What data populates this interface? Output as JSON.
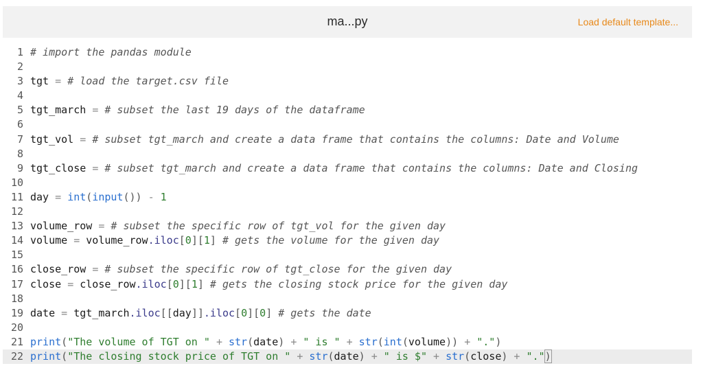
{
  "header": {
    "filename": "ma...py",
    "load_template_label": "Load default template..."
  },
  "colors": {
    "accent_link": "#e8891a",
    "header_bg": "#f2f2f2",
    "active_line_bg": "#ececec"
  },
  "code_lines": [
    {
      "n": "1",
      "tokens": [
        {
          "t": "# import the pandas module",
          "c": "comment"
        }
      ]
    },
    {
      "n": "2",
      "tokens": []
    },
    {
      "n": "3",
      "tokens": [
        {
          "t": "tgt ",
          "c": "var"
        },
        {
          "t": "=",
          "c": "op"
        },
        {
          "t": " ",
          "c": "var"
        },
        {
          "t": "# load the target.csv file",
          "c": "comment"
        }
      ]
    },
    {
      "n": "4",
      "tokens": []
    },
    {
      "n": "5",
      "tokens": [
        {
          "t": "tgt_march ",
          "c": "var"
        },
        {
          "t": "=",
          "c": "op"
        },
        {
          "t": " ",
          "c": "var"
        },
        {
          "t": "# subset the last 19 days of the dataframe",
          "c": "comment"
        }
      ]
    },
    {
      "n": "6",
      "tokens": []
    },
    {
      "n": "7",
      "tokens": [
        {
          "t": "tgt_vol ",
          "c": "var"
        },
        {
          "t": "=",
          "c": "op"
        },
        {
          "t": " ",
          "c": "var"
        },
        {
          "t": "# subset tgt_march and create a data frame that contains the columns: Date and Volume",
          "c": "comment"
        }
      ]
    },
    {
      "n": "8",
      "tokens": []
    },
    {
      "n": "9",
      "tokens": [
        {
          "t": "tgt_close ",
          "c": "var"
        },
        {
          "t": "=",
          "c": "op"
        },
        {
          "t": " ",
          "c": "var"
        },
        {
          "t": "# subset tgt_march and create a data frame that contains the columns: Date and Closing",
          "c": "comment"
        }
      ]
    },
    {
      "n": "10",
      "tokens": []
    },
    {
      "n": "11",
      "tokens": [
        {
          "t": "day ",
          "c": "var"
        },
        {
          "t": "=",
          "c": "op"
        },
        {
          "t": " ",
          "c": "var"
        },
        {
          "t": "int",
          "c": "func"
        },
        {
          "t": "(",
          "c": "punc"
        },
        {
          "t": "input",
          "c": "func"
        },
        {
          "t": "())",
          "c": "punc"
        },
        {
          "t": " ",
          "c": "var"
        },
        {
          "t": "-",
          "c": "op"
        },
        {
          "t": " ",
          "c": "var"
        },
        {
          "t": "1",
          "c": "num"
        }
      ]
    },
    {
      "n": "12",
      "tokens": []
    },
    {
      "n": "13",
      "tokens": [
        {
          "t": "volume_row ",
          "c": "var"
        },
        {
          "t": "=",
          "c": "op"
        },
        {
          "t": " ",
          "c": "var"
        },
        {
          "t": "# subset the specific row of tgt_vol for the given day",
          "c": "comment"
        }
      ]
    },
    {
      "n": "14",
      "tokens": [
        {
          "t": "volume ",
          "c": "var"
        },
        {
          "t": "=",
          "c": "op"
        },
        {
          "t": " volume_row",
          "c": "var"
        },
        {
          "t": ".iloc",
          "c": "attr"
        },
        {
          "t": "[",
          "c": "punc"
        },
        {
          "t": "0",
          "c": "num"
        },
        {
          "t": "][",
          "c": "punc"
        },
        {
          "t": "1",
          "c": "num"
        },
        {
          "t": "]",
          "c": "punc"
        },
        {
          "t": " ",
          "c": "var"
        },
        {
          "t": "# gets the volume for the given day",
          "c": "comment"
        }
      ]
    },
    {
      "n": "15",
      "tokens": []
    },
    {
      "n": "16",
      "tokens": [
        {
          "t": "close_row ",
          "c": "var"
        },
        {
          "t": "=",
          "c": "op"
        },
        {
          "t": " ",
          "c": "var"
        },
        {
          "t": "# subset the specific row of tgt_close for the given day",
          "c": "comment"
        }
      ]
    },
    {
      "n": "17",
      "tokens": [
        {
          "t": "close ",
          "c": "var"
        },
        {
          "t": "=",
          "c": "op"
        },
        {
          "t": " close_row",
          "c": "var"
        },
        {
          "t": ".iloc",
          "c": "attr"
        },
        {
          "t": "[",
          "c": "punc"
        },
        {
          "t": "0",
          "c": "num"
        },
        {
          "t": "][",
          "c": "punc"
        },
        {
          "t": "1",
          "c": "num"
        },
        {
          "t": "]",
          "c": "punc"
        },
        {
          "t": " ",
          "c": "var"
        },
        {
          "t": "# gets the closing stock price for the given day",
          "c": "comment"
        }
      ]
    },
    {
      "n": "18",
      "tokens": []
    },
    {
      "n": "19",
      "tokens": [
        {
          "t": "date ",
          "c": "var"
        },
        {
          "t": "=",
          "c": "op"
        },
        {
          "t": " tgt_march",
          "c": "var"
        },
        {
          "t": ".iloc",
          "c": "attr"
        },
        {
          "t": "[[",
          "c": "punc"
        },
        {
          "t": "day",
          "c": "var"
        },
        {
          "t": "]]",
          "c": "punc"
        },
        {
          "t": ".iloc",
          "c": "attr"
        },
        {
          "t": "[",
          "c": "punc"
        },
        {
          "t": "0",
          "c": "num"
        },
        {
          "t": "][",
          "c": "punc"
        },
        {
          "t": "0",
          "c": "num"
        },
        {
          "t": "]",
          "c": "punc"
        },
        {
          "t": " ",
          "c": "var"
        },
        {
          "t": "# gets the date",
          "c": "comment"
        }
      ]
    },
    {
      "n": "20",
      "tokens": []
    },
    {
      "n": "21",
      "tokens": [
        {
          "t": "print",
          "c": "kw"
        },
        {
          "t": "(",
          "c": "punc"
        },
        {
          "t": "\"The volume of TGT on \"",
          "c": "str"
        },
        {
          "t": " ",
          "c": "var"
        },
        {
          "t": "+",
          "c": "op"
        },
        {
          "t": " ",
          "c": "var"
        },
        {
          "t": "str",
          "c": "func"
        },
        {
          "t": "(",
          "c": "punc"
        },
        {
          "t": "date",
          "c": "var"
        },
        {
          "t": ")",
          "c": "punc"
        },
        {
          "t": " ",
          "c": "var"
        },
        {
          "t": "+",
          "c": "op"
        },
        {
          "t": " ",
          "c": "var"
        },
        {
          "t": "\" is \"",
          "c": "str"
        },
        {
          "t": " ",
          "c": "var"
        },
        {
          "t": "+",
          "c": "op"
        },
        {
          "t": " ",
          "c": "var"
        },
        {
          "t": "str",
          "c": "func"
        },
        {
          "t": "(",
          "c": "punc"
        },
        {
          "t": "int",
          "c": "func"
        },
        {
          "t": "(",
          "c": "punc"
        },
        {
          "t": "volume",
          "c": "var"
        },
        {
          "t": "))",
          "c": "punc"
        },
        {
          "t": " ",
          "c": "var"
        },
        {
          "t": "+",
          "c": "op"
        },
        {
          "t": " ",
          "c": "var"
        },
        {
          "t": "\".\"",
          "c": "str"
        },
        {
          "t": ")",
          "c": "punc"
        }
      ]
    },
    {
      "n": "22",
      "active": true,
      "tokens": [
        {
          "t": "print",
          "c": "kw"
        },
        {
          "t": "(",
          "c": "punc"
        },
        {
          "t": "\"The closing stock price of TGT on \"",
          "c": "str"
        },
        {
          "t": " ",
          "c": "var"
        },
        {
          "t": "+",
          "c": "op"
        },
        {
          "t": " ",
          "c": "var"
        },
        {
          "t": "str",
          "c": "func"
        },
        {
          "t": "(",
          "c": "punc"
        },
        {
          "t": "date",
          "c": "var"
        },
        {
          "t": ")",
          "c": "punc"
        },
        {
          "t": " ",
          "c": "var"
        },
        {
          "t": "+",
          "c": "op"
        },
        {
          "t": " ",
          "c": "var"
        },
        {
          "t": "\" is $\"",
          "c": "str"
        },
        {
          "t": " ",
          "c": "var"
        },
        {
          "t": "+",
          "c": "op"
        },
        {
          "t": " ",
          "c": "var"
        },
        {
          "t": "str",
          "c": "func"
        },
        {
          "t": "(",
          "c": "punc"
        },
        {
          "t": "close",
          "c": "var"
        },
        {
          "t": ")",
          "c": "punc"
        },
        {
          "t": " ",
          "c": "var"
        },
        {
          "t": "+",
          "c": "op"
        },
        {
          "t": " ",
          "c": "var"
        },
        {
          "t": "\".\"",
          "c": "str"
        },
        {
          "t": ")",
          "c": "cursor"
        }
      ]
    }
  ]
}
